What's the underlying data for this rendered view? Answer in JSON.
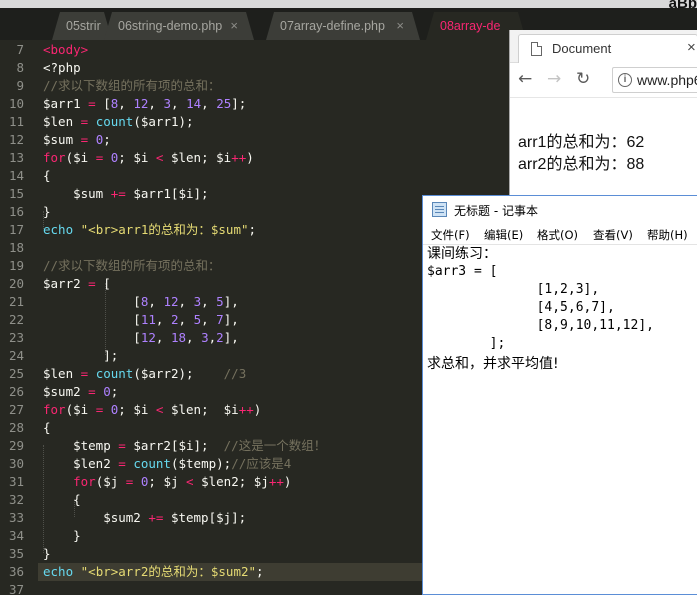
{
  "menubar": {
    "corner_text": "aBb"
  },
  "tabs": [
    {
      "label": "05strir",
      "left": 0
    },
    {
      "label": "06string-demo.php",
      "close": "×"
    },
    {
      "label": "07array-define.php",
      "close": "×"
    },
    {
      "label": "08array-de",
      "close": "×"
    }
  ],
  "editor": {
    "line_numbers": [
      "7",
      "8",
      "9",
      "10",
      "11",
      "12",
      "13",
      "14",
      "15",
      "16",
      "17",
      "18",
      "19",
      "20",
      "21",
      "22",
      "23",
      "24",
      "25",
      "26",
      "27",
      "28",
      "29",
      "30",
      "31",
      "32",
      "33",
      "34",
      "35",
      "36",
      "37"
    ],
    "lines": [
      [
        [
          "k",
          "<body>"
        ]
      ],
      [
        [
          "v",
          "<?php"
        ]
      ],
      [
        [
          "c",
          "//求以下数组的所有项的总和："
        ]
      ],
      [
        [
          "v",
          "$arr1 "
        ],
        [
          "k",
          "="
        ],
        [
          "v",
          " ["
        ],
        [
          "n",
          "8"
        ],
        [
          "v",
          ", "
        ],
        [
          "n",
          "12"
        ],
        [
          "v",
          ", "
        ],
        [
          "n",
          "3"
        ],
        [
          "v",
          ", "
        ],
        [
          "n",
          "14"
        ],
        [
          "v",
          ", "
        ],
        [
          "n",
          "25"
        ],
        [
          "v",
          "];"
        ]
      ],
      [
        [
          "v",
          "$len "
        ],
        [
          "k",
          "="
        ],
        [
          "v",
          " "
        ],
        [
          "f",
          "count"
        ],
        [
          "v",
          "($arr1);"
        ]
      ],
      [
        [
          "v",
          "$sum "
        ],
        [
          "k",
          "="
        ],
        [
          "v",
          " "
        ],
        [
          "n",
          "0"
        ],
        [
          "v",
          ";"
        ]
      ],
      [
        [
          "k",
          "for"
        ],
        [
          "v",
          "($i "
        ],
        [
          "k",
          "="
        ],
        [
          "v",
          " "
        ],
        [
          "n",
          "0"
        ],
        [
          "v",
          "; $i "
        ],
        [
          "k",
          "<"
        ],
        [
          "v",
          " $len; $i"
        ],
        [
          "k",
          "++"
        ],
        [
          "v",
          ")"
        ]
      ],
      [
        [
          "v",
          "{"
        ]
      ],
      [
        [
          "v",
          "    $sum "
        ],
        [
          "k",
          "+="
        ],
        [
          "v",
          " $arr1[$i];"
        ]
      ],
      [
        [
          "v",
          "}"
        ]
      ],
      [
        [
          "f",
          "echo"
        ],
        [
          "v",
          " "
        ],
        [
          "s",
          "\"<br>arr1的总和为：$sum\""
        ],
        [
          "v",
          ";"
        ]
      ],
      [
        [
          "v",
          ""
        ]
      ],
      [
        [
          "c",
          "//求以下数组的所有项的总和："
        ]
      ],
      [
        [
          "v",
          "$arr2 "
        ],
        [
          "k",
          "="
        ],
        [
          "v",
          " ["
        ]
      ],
      [
        [
          "v",
          "            ["
        ],
        [
          "n",
          "8"
        ],
        [
          "v",
          ", "
        ],
        [
          "n",
          "12"
        ],
        [
          "v",
          ", "
        ],
        [
          "n",
          "3"
        ],
        [
          "v",
          ", "
        ],
        [
          "n",
          "5"
        ],
        [
          "v",
          "],"
        ]
      ],
      [
        [
          "v",
          "            ["
        ],
        [
          "n",
          "11"
        ],
        [
          "v",
          ", "
        ],
        [
          "n",
          "2"
        ],
        [
          "v",
          ", "
        ],
        [
          "n",
          "5"
        ],
        [
          "v",
          ", "
        ],
        [
          "n",
          "7"
        ],
        [
          "v",
          "],"
        ]
      ],
      [
        [
          "v",
          "            ["
        ],
        [
          "n",
          "12"
        ],
        [
          "v",
          ", "
        ],
        [
          "n",
          "18"
        ],
        [
          "v",
          ", "
        ],
        [
          "n",
          "3"
        ],
        [
          "v",
          ","
        ],
        [
          "n",
          "2"
        ],
        [
          "v",
          "],"
        ]
      ],
      [
        [
          "v",
          "        ];"
        ]
      ],
      [
        [
          "v",
          "$len "
        ],
        [
          "k",
          "="
        ],
        [
          "v",
          " "
        ],
        [
          "f",
          "count"
        ],
        [
          "v",
          "($arr2);    "
        ],
        [
          "c",
          "//3"
        ]
      ],
      [
        [
          "v",
          "$sum2 "
        ],
        [
          "k",
          "="
        ],
        [
          "v",
          " "
        ],
        [
          "n",
          "0"
        ],
        [
          "v",
          ";"
        ]
      ],
      [
        [
          "k",
          "for"
        ],
        [
          "v",
          "($i "
        ],
        [
          "k",
          "="
        ],
        [
          "v",
          " "
        ],
        [
          "n",
          "0"
        ],
        [
          "v",
          "; $i "
        ],
        [
          "k",
          "<"
        ],
        [
          "v",
          " $len;  $i"
        ],
        [
          "k",
          "++"
        ],
        [
          "v",
          ")"
        ]
      ],
      [
        [
          "v",
          "{"
        ]
      ],
      [
        [
          "v",
          "    $temp "
        ],
        [
          "k",
          "="
        ],
        [
          "v",
          " $arr2[$i];  "
        ],
        [
          "c",
          "//这是一个数组！"
        ]
      ],
      [
        [
          "v",
          "    $len2 "
        ],
        [
          "k",
          "="
        ],
        [
          "v",
          " "
        ],
        [
          "f",
          "count"
        ],
        [
          "v",
          "($temp);"
        ],
        [
          "c",
          "//应该是4"
        ]
      ],
      [
        [
          "v",
          "    "
        ],
        [
          "k",
          "for"
        ],
        [
          "v",
          "($j "
        ],
        [
          "k",
          "="
        ],
        [
          "v",
          " "
        ],
        [
          "n",
          "0"
        ],
        [
          "v",
          "; $j "
        ],
        [
          "k",
          "<"
        ],
        [
          "v",
          " $len2; $j"
        ],
        [
          "k",
          "++"
        ],
        [
          "v",
          ")"
        ]
      ],
      [
        [
          "v",
          "    {"
        ]
      ],
      [
        [
          "v",
          "        $sum2 "
        ],
        [
          "k",
          "+="
        ],
        [
          "v",
          " $temp[$j];"
        ]
      ],
      [
        [
          "v",
          "    }"
        ]
      ],
      [
        [
          "v",
          "}"
        ]
      ],
      [
        [
          "f",
          "echo"
        ],
        [
          "v",
          " "
        ],
        [
          "s",
          "\"<br>arr2的总和为：$sum2\""
        ],
        [
          "v",
          ";"
        ]
      ],
      [
        [
          "v",
          ""
        ]
      ]
    ]
  },
  "browser": {
    "tab_title": "Document",
    "tab_close": "×",
    "back": "←",
    "forward": "→",
    "reload": "↻",
    "info": "i",
    "url": "www.php6",
    "output": [
      "arr1的总和为：62",
      "arr2的总和为：88"
    ]
  },
  "notepad": {
    "title": "无标题 - 记事本",
    "menus": [
      "文件(F)",
      "编辑(E)",
      "格式(O)",
      "查看(V)",
      "帮助(H)"
    ],
    "lines": [
      "课间练习：",
      "$arr3 = [",
      "              [1,2,3],",
      "              [4,5,6,7],",
      "              [8,9,10,11,12],",
      "        ];",
      "求总和，并求平均值!"
    ]
  }
}
